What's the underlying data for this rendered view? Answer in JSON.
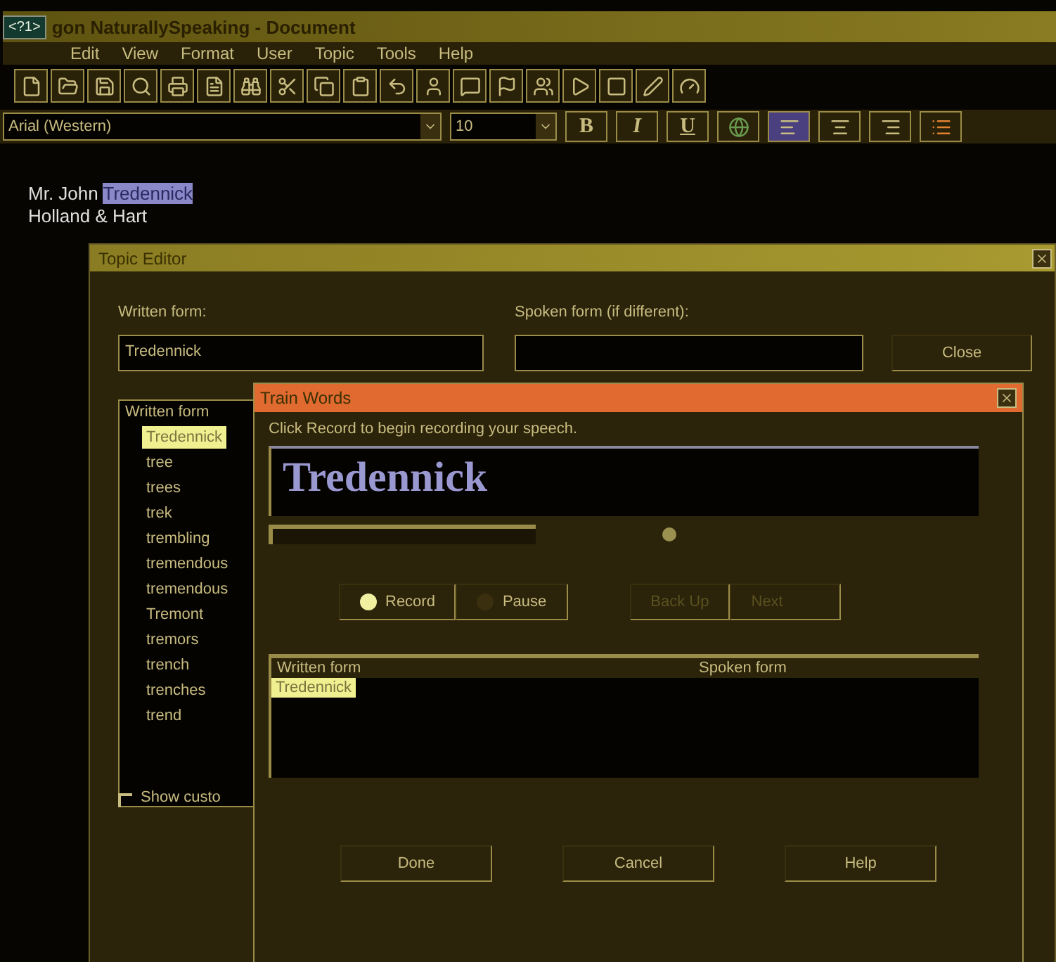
{
  "app_badge": "<?1>",
  "window": {
    "title": "gon NaturallySpeaking - Document"
  },
  "menu": [
    "Edit",
    "View",
    "Format",
    "User",
    "Topic",
    "Tools",
    "Help"
  ],
  "toolbar": [
    {
      "kind": "file"
    },
    {
      "kind": "folder"
    },
    {
      "kind": "save"
    },
    {
      "kind": "search"
    },
    {
      "kind": "printer"
    },
    {
      "kind": "preview"
    },
    {
      "kind": "binoculars"
    },
    {
      "kind": "scissors"
    },
    {
      "kind": "copy"
    },
    {
      "kind": "clipboard"
    },
    {
      "kind": "undo"
    },
    {
      "kind": "person"
    },
    {
      "kind": "chat"
    },
    {
      "kind": "flag"
    },
    {
      "kind": "people"
    },
    {
      "kind": "play"
    },
    {
      "kind": "stop"
    },
    {
      "kind": "pen"
    },
    {
      "kind": "meter"
    }
  ],
  "format_bar": {
    "font": "Arial (Western)",
    "size": "10",
    "bold": "B",
    "italic": "I",
    "underline": "U",
    "align": [
      {
        "selected": true
      },
      {
        "selected": false
      },
      {
        "selected": false
      }
    ]
  },
  "document": {
    "lines": [
      {
        "parts": [
          {
            "text": "Mr. John ",
            "selected": false
          },
          {
            "text": "Tredennick",
            "selected": true
          }
        ]
      },
      {
        "parts": [
          {
            "text": "Holland & Hart",
            "selected": false
          }
        ]
      }
    ]
  },
  "topic_editor": {
    "title": "Topic Editor",
    "written_label": "Written form:",
    "written_value": "Tredennick",
    "spoken_label": "Spoken form (if different):",
    "close": "Close",
    "list_header": "Written form",
    "words": [
      {
        "text": "Tredennick",
        "selected": true
      },
      {
        "text": "tree",
        "selected": false
      },
      {
        "text": "trees",
        "selected": false
      },
      {
        "text": "trek",
        "selected": false
      },
      {
        "text": "trembling",
        "selected": false
      },
      {
        "text": "tremendous",
        "selected": false
      },
      {
        "text": "tremendous",
        "selected": false
      },
      {
        "text": "Tremont",
        "selected": false
      },
      {
        "text": "tremors",
        "selected": false
      },
      {
        "text": "trench",
        "selected": false
      },
      {
        "text": "trenches",
        "selected": false
      },
      {
        "text": "trend",
        "selected": false
      }
    ],
    "show_custom": {
      "label": "Show custo",
      "checked": false
    }
  },
  "train_words": {
    "title": "Train Words",
    "instruction": "Click Record to begin recording your speech.",
    "word": "Tredennick",
    "level": 0.0,
    "record": {
      "label": "Record",
      "selected": true
    },
    "pause": {
      "label": "Pause",
      "selected": false
    },
    "back_up": {
      "label": "Back Up",
      "disabled": true
    },
    "next": {
      "label": "Next",
      "disabled": true
    },
    "columns": [
      "Written form",
      "Spoken form"
    ],
    "rows": [
      {
        "written": "Tredennick",
        "spoken": "",
        "selected": true
      }
    ],
    "buttons": [
      "Done",
      "Cancel",
      "Help"
    ]
  }
}
